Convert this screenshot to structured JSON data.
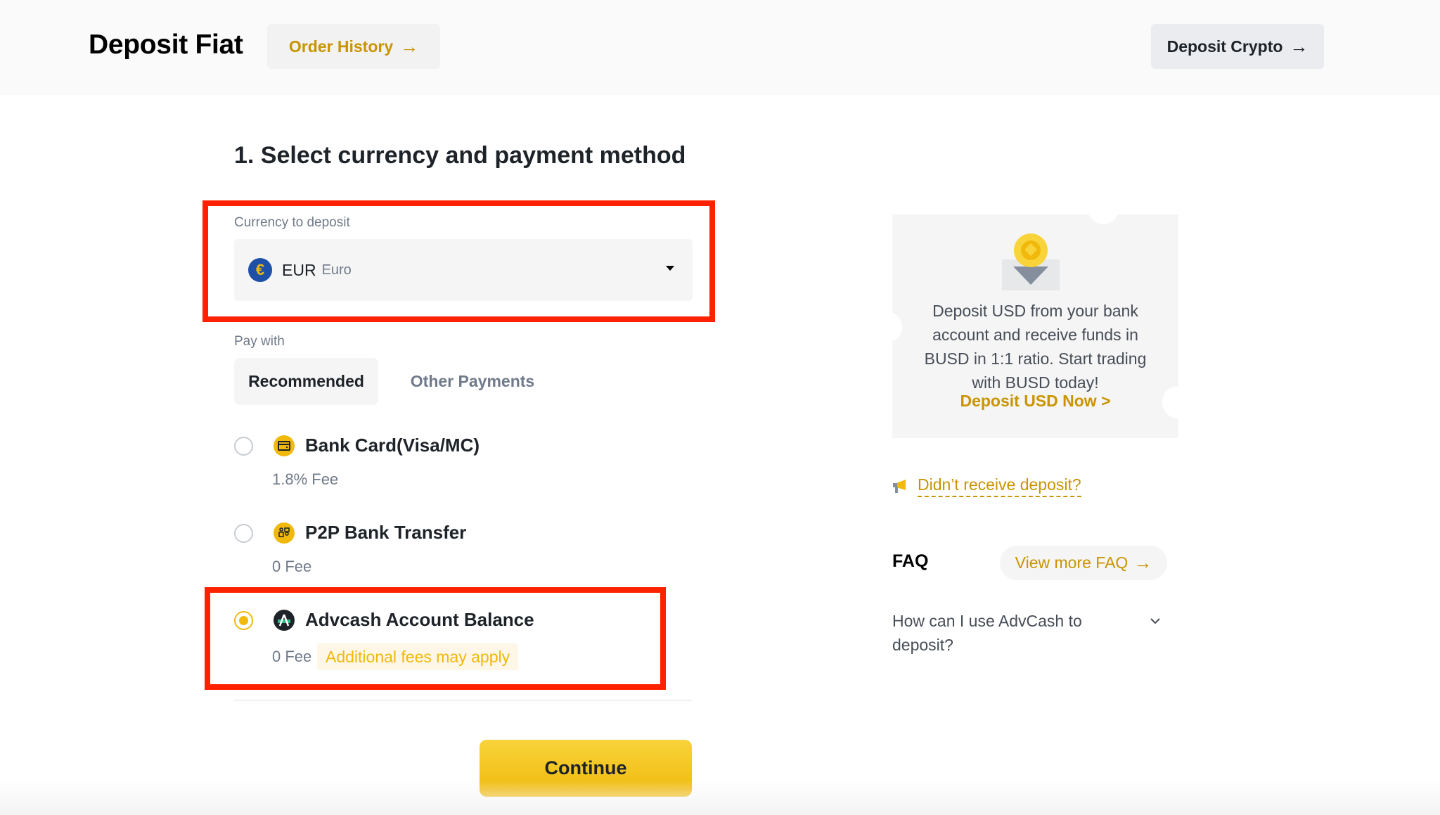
{
  "header": {
    "title": "Deposit Fiat",
    "order_history_label": "Order History",
    "deposit_crypto_label": "Deposit Crypto",
    "arrow_icon": "→"
  },
  "form": {
    "step_title": "1. Select currency and payment method",
    "currency_label": "Currency to deposit",
    "currency": {
      "icon_symbol": "€",
      "code": "EUR",
      "name": "Euro"
    },
    "pay_with_label": "Pay with",
    "tabs": [
      {
        "label": "Recommended",
        "active": true
      },
      {
        "label": "Other Payments",
        "active": false
      }
    ],
    "methods": [
      {
        "name": "Bank Card(Visa/MC)",
        "fee": "1.8% Fee",
        "selected": false,
        "icon": "bank-card-icon"
      },
      {
        "name": "P2P Bank Transfer",
        "fee": "0 Fee",
        "selected": false,
        "icon": "p2p-transfer-icon"
      },
      {
        "name": "Advcash Account Balance",
        "fee": "0 Fee",
        "note": "Additional fees may apply",
        "selected": true,
        "icon": "advcash-icon"
      }
    ],
    "continue_label": "Continue"
  },
  "sidebar": {
    "promo_text": "Deposit USD from your bank account and receive funds in BUSD in 1:1 ratio. Start trading with BUSD today!",
    "promo_link": "Deposit USD Now >",
    "notice_link": "Didn’t receive deposit?",
    "faq_title": "FAQ",
    "faq_more_label": "View more FAQ",
    "faq_items": [
      {
        "question": "How can I use AdvCash to deposit?"
      }
    ]
  },
  "colors": {
    "accent": "#F0B90B",
    "link": "#C99400",
    "highlight_box": "#FF2200"
  }
}
